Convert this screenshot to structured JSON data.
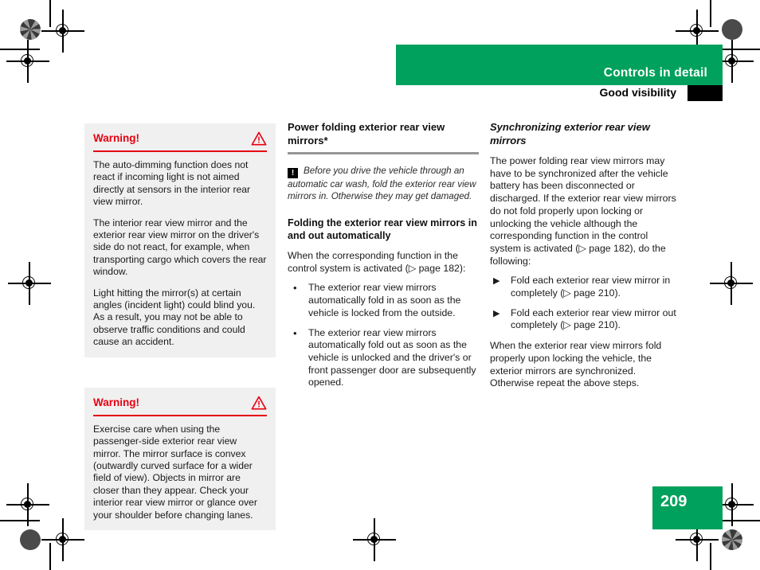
{
  "theme": {
    "brand_green": "#00a15c",
    "warning_red": "#e60012",
    "rule_grey": "#969696",
    "warnbox_bg": "#f0f0f0"
  },
  "header": {
    "chapter": "Controls in detail",
    "section": "Good visibility"
  },
  "footer": {
    "page_number": "209"
  },
  "left_column": {
    "warnings": [
      {
        "title": "Warning!",
        "icon": "warning-triangle-icon",
        "paragraphs": [
          "The auto-dimming function does not react if incoming light is not aimed directly at sensors in the interior rear view mirror.",
          "The interior rear view mirror and the exterior rear view mirror on the driver's side do not react, for example, when transporting cargo which covers the rear window.",
          "Light hitting the mirror(s) at certain angles (incident light) could blind you. As a result, you may not be able to observe traffic conditions and could cause an accident."
        ]
      },
      {
        "title": "Warning!",
        "icon": "warning-triangle-icon",
        "paragraphs": [
          "Exercise care when using the passenger-side exterior rear view mirror. The mirror surface is convex (outwardly curved surface for a wider field of view). Objects in mirror are closer than they appear. Check your interior rear view mirror or glance over your shoulder before changing lanes."
        ]
      }
    ]
  },
  "middle_column": {
    "title": "Power folding exterior rear view mirrors*",
    "note": {
      "icon": "exclamation-box-icon",
      "icon_glyph": "!",
      "text": "Before you drive the vehicle through an automatic car wash, fold the exterior rear view mirrors in. Otherwise they may get damaged."
    },
    "subtitle": "Folding the exterior rear view mirrors in and out automatically",
    "intro": "When the corresponding function in the control system is activated (▷ page 182):",
    "bullets": [
      {
        "marker": "•",
        "text": "The exterior rear view mirrors automatically fold in as soon as the vehicle is locked from the outside."
      },
      {
        "marker": "•",
        "text": "The exterior rear view mirrors automatically fold out as soon as the vehicle is unlocked and the driver's or front passenger door are subsequently opened."
      }
    ]
  },
  "right_column": {
    "title": "Synchronizing exterior rear view mirrors",
    "intro": "The power folding rear view mirrors may have to be synchronized after the vehicle battery has been disconnected or discharged. If the exterior rear view mirrors do not fold properly upon locking or unlocking the vehicle although the corresponding function in the control system is activated (▷ page 182), do the following:",
    "steps": [
      {
        "marker": "▶",
        "text": "Fold each exterior rear view mirror in completely (▷ page 210)."
      },
      {
        "marker": "▶",
        "text": "Fold each exterior rear view mirror out completely (▷ page 210)."
      }
    ],
    "outro": "When the exterior rear view mirrors fold properly upon locking the vehicle, the exterior mirrors are synchronized. Otherwise repeat the above steps."
  }
}
